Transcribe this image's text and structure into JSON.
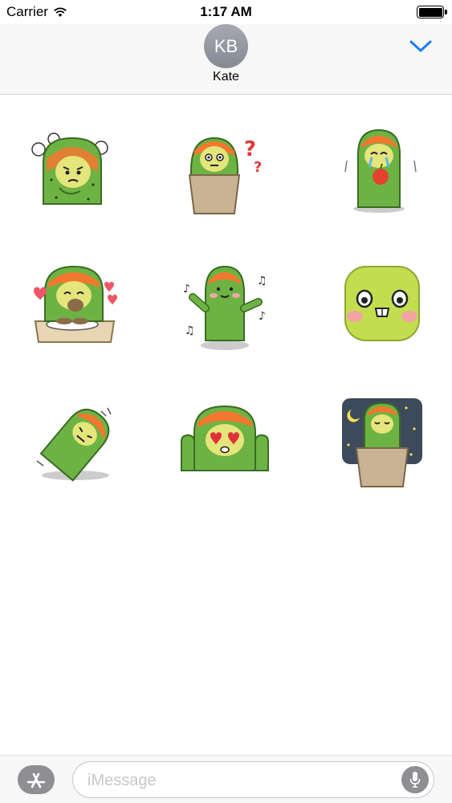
{
  "status_bar": {
    "carrier": "Carrier",
    "time": "1:17 AM",
    "battery_level": 1.0
  },
  "header": {
    "avatar_initials": "KB",
    "contact_name": "Kate",
    "collapse_icon": "chevron-down-icon",
    "accent_color": "#1a7cf5"
  },
  "stickers": [
    {
      "name": "angry-cactus-sticker"
    },
    {
      "name": "confused-cactus-pot-sticker"
    },
    {
      "name": "crying-cactus-apple-sticker"
    },
    {
      "name": "eating-cactus-hearts-sticker"
    },
    {
      "name": "dancing-cactus-sticker"
    },
    {
      "name": "green-face-sticker"
    },
    {
      "name": "sleepy-cactus-lying-sticker"
    },
    {
      "name": "heart-eyes-cactus-sticker"
    },
    {
      "name": "sleeping-cactus-night-sticker"
    }
  ],
  "compose": {
    "placeholder": "iMessage",
    "app_store_icon": "app-store-icon",
    "mic_icon": "microphone-icon"
  }
}
